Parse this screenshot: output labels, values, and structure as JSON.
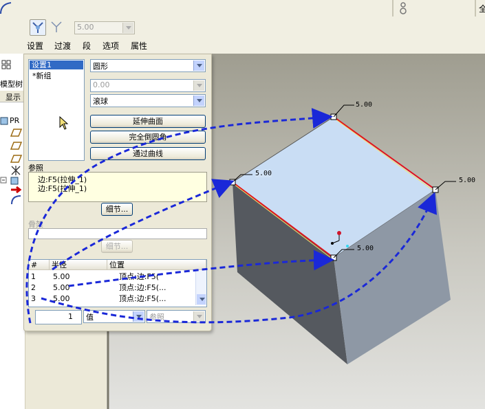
{
  "toolbar": {
    "radius_value": "5.00",
    "tabs": [
      "设置",
      "过渡",
      "段",
      "选项",
      "属性"
    ],
    "right_button": "全"
  },
  "left_strip": {
    "tab_label": "模型树",
    "display_label": "显示",
    "root_label": "PR"
  },
  "panel": {
    "sets": [
      "设置1",
      "*新组"
    ],
    "shape_value": "圆形",
    "disabled_value": "0.00",
    "method_value": "滚球",
    "extend_button": "延伸曲面",
    "full_round_button": "完全倒圆角",
    "through_curve_button": "通过曲线",
    "references_label": "参照",
    "references": [
      "边:F5(拉伸_1)",
      "边:F5(拉伸_1)"
    ],
    "details_button": "细节...",
    "skeleton_label": "骨架",
    "details_button_2": "细节...",
    "table": {
      "headers": [
        "#",
        "半径",
        "位置"
      ],
      "rows": [
        {
          "num": "1",
          "radius": "5.00",
          "location": "顶点:边:F5("
        },
        {
          "num": "2",
          "radius": "5.00",
          "location": "顶点:边:F5(..."
        },
        {
          "num": "3",
          "radius": "5.00",
          "location": "顶点:边:F5(..."
        }
      ]
    },
    "bottom_value": "1",
    "bottom_combo": "值",
    "bottom_ref": "参照"
  },
  "graphics": {
    "dims": [
      "5.00",
      "5.00",
      "5.00",
      "5.00"
    ],
    "colors": {
      "edge": "#e0141e",
      "top_face": "#c9ddf4",
      "left_face": "#55595f",
      "right_face": "#8e98a5",
      "arrow": "#1a28d8"
    }
  }
}
